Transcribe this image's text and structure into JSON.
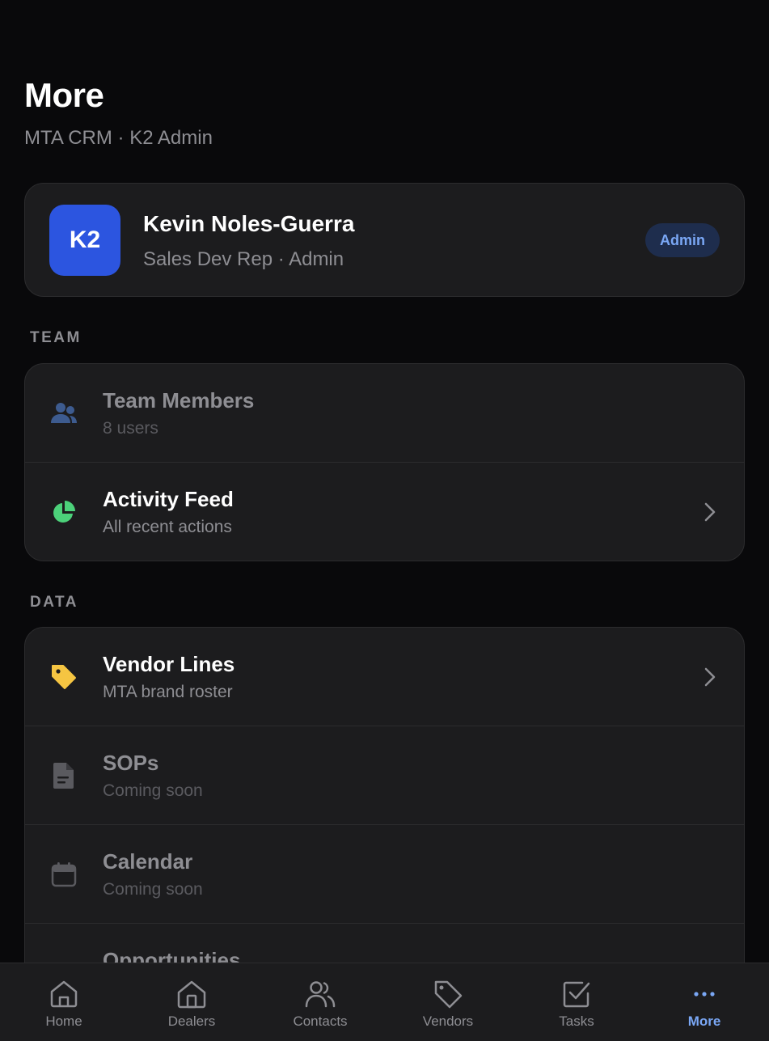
{
  "header": {
    "title": "More",
    "subtitle": "MTA CRM · K2 Admin"
  },
  "profile": {
    "initials": "K2",
    "name": "Kevin Noles-Guerra",
    "role": "Sales Dev Rep · Admin",
    "badge": "Admin",
    "avatar_color": "#2c55e0"
  },
  "sections": {
    "team": {
      "label": "TEAM",
      "items": [
        {
          "title": "Team Members",
          "subtitle": "8 users",
          "icon": "people-icon",
          "icon_color": "#3d5b8f",
          "enabled": false
        },
        {
          "title": "Activity Feed",
          "subtitle": "All recent actions",
          "icon": "pie-chart-icon",
          "icon_color": "#4cd17a",
          "enabled": true
        }
      ]
    },
    "data": {
      "label": "DATA",
      "items": [
        {
          "title": "Vendor Lines",
          "subtitle": "MTA brand roster",
          "icon": "tag-icon",
          "icon_color": "#f5c542",
          "enabled": true
        },
        {
          "title": "SOPs",
          "subtitle": "Coming soon",
          "icon": "document-icon",
          "icon_color": "#5a5a5f",
          "enabled": false
        },
        {
          "title": "Calendar",
          "subtitle": "Coming soon",
          "icon": "calendar-icon",
          "icon_color": "#5a5a5f",
          "enabled": false
        },
        {
          "title": "Opportunities",
          "subtitle": "",
          "icon": "opportunities-icon",
          "icon_color": "#5a5a5f",
          "enabled": false
        }
      ]
    }
  },
  "tabbar": {
    "tabs": [
      {
        "label": "Home",
        "icon": "home-icon",
        "active": false
      },
      {
        "label": "Dealers",
        "icon": "dealers-icon",
        "active": false
      },
      {
        "label": "Contacts",
        "icon": "contacts-icon",
        "active": false
      },
      {
        "label": "Vendors",
        "icon": "tag-outline-icon",
        "active": false
      },
      {
        "label": "Tasks",
        "icon": "checkbox-icon",
        "active": false
      },
      {
        "label": "More",
        "icon": "more-dots-icon",
        "active": true
      }
    ]
  },
  "colors": {
    "background": "#09090b",
    "card": "#1c1c1e",
    "accent": "#7aa7f5"
  }
}
